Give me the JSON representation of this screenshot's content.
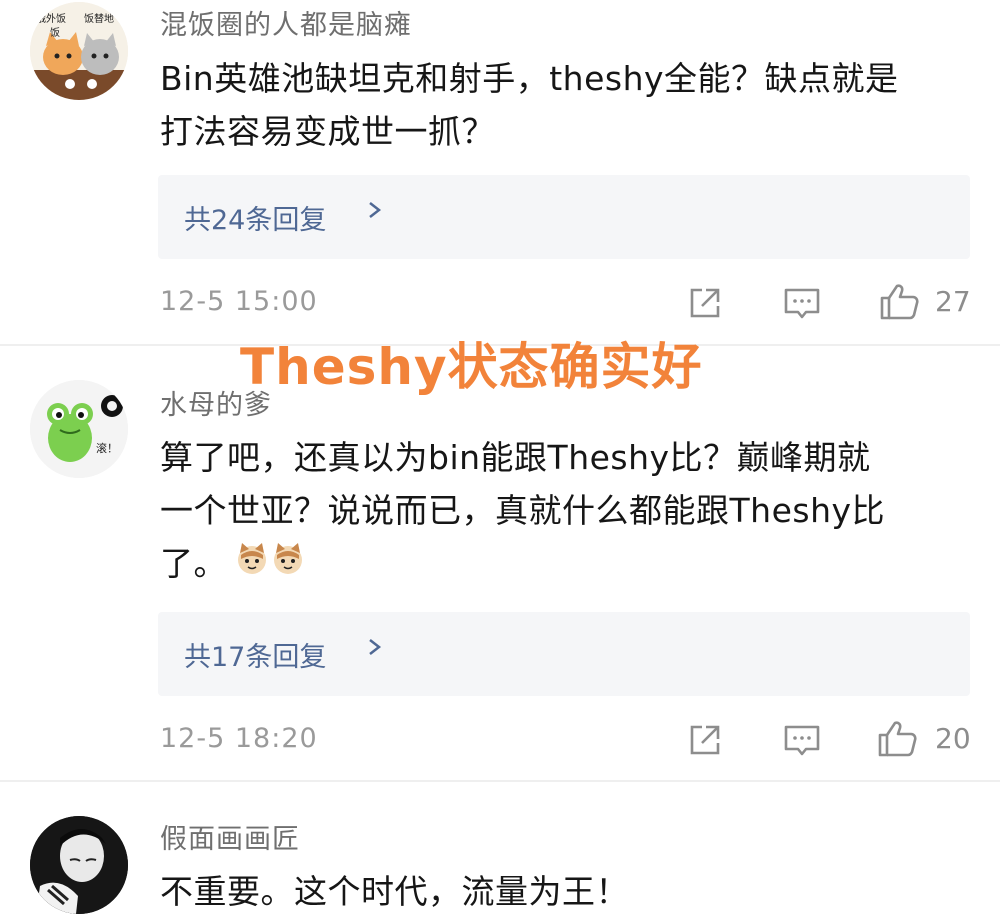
{
  "overlay_text": "Theshy状态确实好",
  "comments": [
    {
      "username": "混饭圈的人都是脑瘫",
      "avatar_text": [
        "俄外饭",
        "饭替地",
        "饭"
      ],
      "text": [
        "Bin英雄池缺坦克和射手，theshy全能？缺点就是",
        "打法容易变成世一抓？"
      ],
      "replies": "共24条回复",
      "time": "12-5 15:00",
      "likes": "27"
    },
    {
      "username": "水母的爹",
      "avatar_text": [
        "滚！"
      ],
      "text": [
        "算了吧，还真以为bin能跟Theshy比？巅峰期就",
        "一个世亚？说说而已，真就什么都能跟Theshy比",
        "了。"
      ],
      "replies": "共17条回复",
      "time": "12-5 18:20",
      "likes": "20"
    },
    {
      "username": "假面画画匠",
      "text": [
        "不重要。这个时代，流量为王！"
      ]
    }
  ],
  "icons": {
    "share": "share-icon",
    "comment": "comment-icon",
    "like": "thumbs-up-icon",
    "chevron": "chevron-right-icon"
  },
  "colors": {
    "overlay": "#f2833a",
    "reply_link": "#4f6894",
    "meta": "#9a9a9a"
  }
}
